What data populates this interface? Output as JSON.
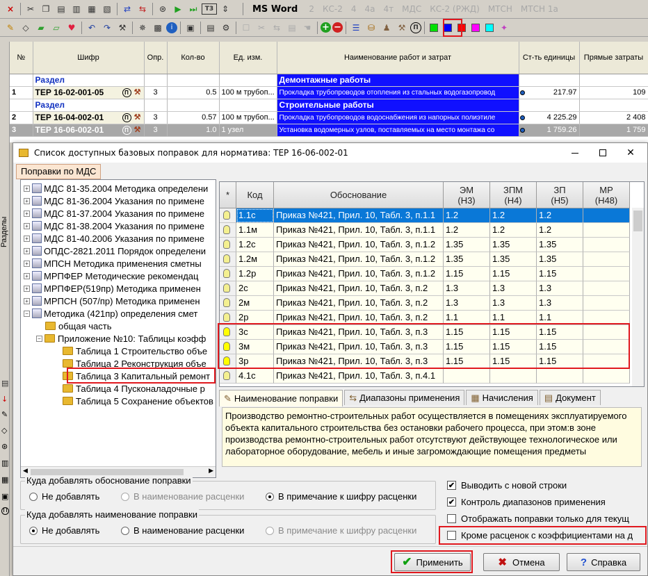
{
  "toolbar": {
    "labels": [
      "MS Word",
      "2",
      "КС-2",
      "4",
      "4а",
      "4т",
      "МДС",
      "КС-2 (РЖД)",
      "МТСН",
      "МТСН 1а"
    ],
    "color_swatches": [
      "#00e000",
      "#0000ff",
      "#ff0000",
      "#ff00ff",
      "#00ffff"
    ],
    "markers": {
      "x": "×",
      "t3": "T3",
      "pi": "П"
    }
  },
  "side": {
    "vertical_label": "Разделы"
  },
  "main_grid": {
    "columns": [
      "№",
      "Шифр",
      "Опр.",
      "Кол-во",
      "Ед. изм.",
      "Наименование работ и затрат",
      "Ст-ть единицы",
      "Прямые затраты"
    ],
    "rows": [
      {
        "type": "section",
        "code": "Раздел",
        "name": "Демонтажные работы"
      },
      {
        "type": "item",
        "n": "1",
        "code": "ТЕР 16-02-001-05",
        "opr": "3",
        "qty": "0.5",
        "unit": "100 м трубоп...",
        "name": "Прокладка трубопроводов отопления из стальных водогазопровод",
        "cost": "217.97",
        "direct": "109"
      },
      {
        "type": "section",
        "code": "Раздел",
        "name": "Строительные работы"
      },
      {
        "type": "item",
        "n": "2",
        "code": "ТЕР 16-04-002-01",
        "opr": "3",
        "qty": "0.57",
        "unit": "100 м трубоп...",
        "name": "Прокладка трубопроводов водоснабжения из напорных полиэтиле",
        "cost": "4 225.29",
        "direct": "2 408"
      },
      {
        "type": "selected",
        "n": "3",
        "code": "ТЕР 16-06-002-01",
        "opr": "3",
        "qty": "1.0",
        "unit": "1 узел",
        "name": "Установка водомерных узлов, поставляемых на место монтажа со",
        "cost": "1 759.26",
        "direct": "1 759"
      }
    ]
  },
  "dialog": {
    "title": "Список доступных базовых поправок для норматива: ТЕР 16-06-002-01",
    "controls": {
      "close": "✕"
    },
    "top_tab": "Поправки по МДС",
    "tree": [
      {
        "label": "МДС 81-35.2004 Методика определени",
        "level": 0,
        "kind": "book",
        "exp": "+"
      },
      {
        "label": "МДС 81-36.2004 Указания по примене",
        "level": 0,
        "kind": "book",
        "exp": "+"
      },
      {
        "label": "МДС 81-37.2004 Указания по примене",
        "level": 0,
        "kind": "book",
        "exp": "+"
      },
      {
        "label": "МДС 81-38.2004 Указания по примене",
        "level": 0,
        "kind": "book",
        "exp": "+"
      },
      {
        "label": "МДС 81-40.2006 Указания по примене",
        "level": 0,
        "kind": "book",
        "exp": "+"
      },
      {
        "label": "ОПДС-2821.2011 Порядок определени",
        "level": 0,
        "kind": "book",
        "exp": "+"
      },
      {
        "label": "МПСН Методика применения сметны",
        "level": 0,
        "kind": "book",
        "exp": "+"
      },
      {
        "label": "МРПФЕР Методические рекомендац",
        "level": 0,
        "kind": "book",
        "exp": "+"
      },
      {
        "label": "МРПФЕР(519пр) Методика применен",
        "level": 0,
        "kind": "book",
        "exp": "+"
      },
      {
        "label": "МРПСН (507/пр) Методика применен",
        "level": 0,
        "kind": "book",
        "exp": "+"
      },
      {
        "label": "Методика (421пр) определения смет",
        "level": 0,
        "kind": "book",
        "exp": "−"
      },
      {
        "label": "общая часть",
        "level": 1,
        "kind": "folder",
        "exp": ""
      },
      {
        "label": "Приложение №10: Таблицы коэфф",
        "level": 1,
        "kind": "folder",
        "exp": "−"
      },
      {
        "label": "Таблица 1 Строительство объе",
        "level": 2,
        "kind": "folder",
        "exp": ""
      },
      {
        "label": "Таблица 2 Реконструкция объе",
        "level": 2,
        "kind": "folder",
        "exp": ""
      },
      {
        "label": "Таблица 3 Капитальный ремонт",
        "level": 2,
        "kind": "folder",
        "exp": ""
      },
      {
        "label": "Таблица 4 Пусконаладочные р",
        "level": 2,
        "kind": "folder",
        "exp": ""
      },
      {
        "label": "Таблица 5 Сохранение объектов",
        "level": 2,
        "kind": "folder",
        "exp": ""
      }
    ],
    "grid": {
      "columns": [
        "*",
        "Код",
        "Обоснование",
        "ЭМ\n(Н3)",
        "ЗПМ\n(Н4)",
        "ЗП\n(Н5)",
        "МР\n(Н48)"
      ],
      "rows": [
        {
          "code": "1.1с",
          "basis": "Приказ №421, Прил. 10, Табл. 3, п.1.1",
          "em": "1.2",
          "zpm": "1.2",
          "zp": "1.2",
          "mr": "",
          "on": false
        },
        {
          "code": "1.1м",
          "basis": "Приказ №421, Прил. 10, Табл. 3, п.1.1",
          "em": "1.2",
          "zpm": "1.2",
          "zp": "1.2",
          "mr": "",
          "on": false
        },
        {
          "code": "1.2с",
          "basis": "Приказ №421, Прил. 10, Табл. 3, п.1.2",
          "em": "1.35",
          "zpm": "1.35",
          "zp": "1.35",
          "mr": "",
          "on": false
        },
        {
          "code": "1.2м",
          "basis": "Приказ №421, Прил. 10, Табл. 3, п.1.2",
          "em": "1.35",
          "zpm": "1.35",
          "zp": "1.35",
          "mr": "",
          "on": false
        },
        {
          "code": "1.2р",
          "basis": "Приказ №421, Прил. 10, Табл. 3, п.1.2",
          "em": "1.15",
          "zpm": "1.15",
          "zp": "1.15",
          "mr": "",
          "on": false
        },
        {
          "code": "2с",
          "basis": "Приказ №421, Прил. 10, Табл. 3, п.2",
          "em": "1.3",
          "zpm": "1.3",
          "zp": "1.3",
          "mr": "",
          "on": false
        },
        {
          "code": "2м",
          "basis": "Приказ №421, Прил. 10, Табл. 3, п.2",
          "em": "1.3",
          "zpm": "1.3",
          "zp": "1.3",
          "mr": "",
          "on": false
        },
        {
          "code": "2р",
          "basis": "Приказ №421, Прил. 10, Табл. 3, п.2",
          "em": "1.1",
          "zpm": "1.1",
          "zp": "1.1",
          "mr": "",
          "on": false
        },
        {
          "code": "3с",
          "basis": "Приказ №421, Прил. 10, Табл. 3, п.3",
          "em": "1.15",
          "zpm": "1.15",
          "zp": "1.15",
          "mr": "",
          "on": true
        },
        {
          "code": "3м",
          "basis": "Приказ №421, Прил. 10, Табл. 3, п.3",
          "em": "1.15",
          "zpm": "1.15",
          "zp": "1.15",
          "mr": "",
          "on": true
        },
        {
          "code": "3р",
          "basis": "Приказ №421, Прил. 10, Табл. 3, п.3",
          "em": "1.15",
          "zpm": "1.15",
          "zp": "1.15",
          "mr": "",
          "on": true
        },
        {
          "code": "4.1с",
          "basis": "Приказ №421, Прил. 10, Табл. 3, п.4.1",
          "em": "",
          "zpm": "",
          "zp": "",
          "mr": "",
          "on": false
        }
      ]
    },
    "tabs": [
      "Наименование поправки",
      "Диапазоны применения",
      "Начисления",
      "Документ"
    ],
    "description": "Производство ремонтно-строительных работ осуществляется в помещениях эксплуатируемого объекта капитального строительства без остановки рабочего процесса, при этом:в зоне производства ремонтно-строительных работ отсутствуют действующее технологическое или лабораторное оборудование, мебель и иные загромождающие помещения предметы",
    "group1": {
      "title": "Куда добавлять обоснование поправки",
      "opts": [
        "Не добавлять",
        "В наименование расценки",
        "В примечание к шифру расценки"
      ]
    },
    "group2": {
      "title": "Куда добавлять наименование поправки",
      "opts": [
        "Не добавлять",
        "В наименование расценки",
        "В примечание к шифру расценки"
      ]
    },
    "checks": [
      {
        "label": "Выводить с новой строки",
        "checked": true
      },
      {
        "label": "Контроль диапазонов применения",
        "checked": true
      },
      {
        "label": "Отображать поправки только для текущ",
        "checked": false
      },
      {
        "label": "Кроме расценок с коэффициентами на д",
        "checked": false
      }
    ],
    "buttons": {
      "apply": "Применить",
      "cancel": "Отмена",
      "help": "Справка"
    }
  }
}
